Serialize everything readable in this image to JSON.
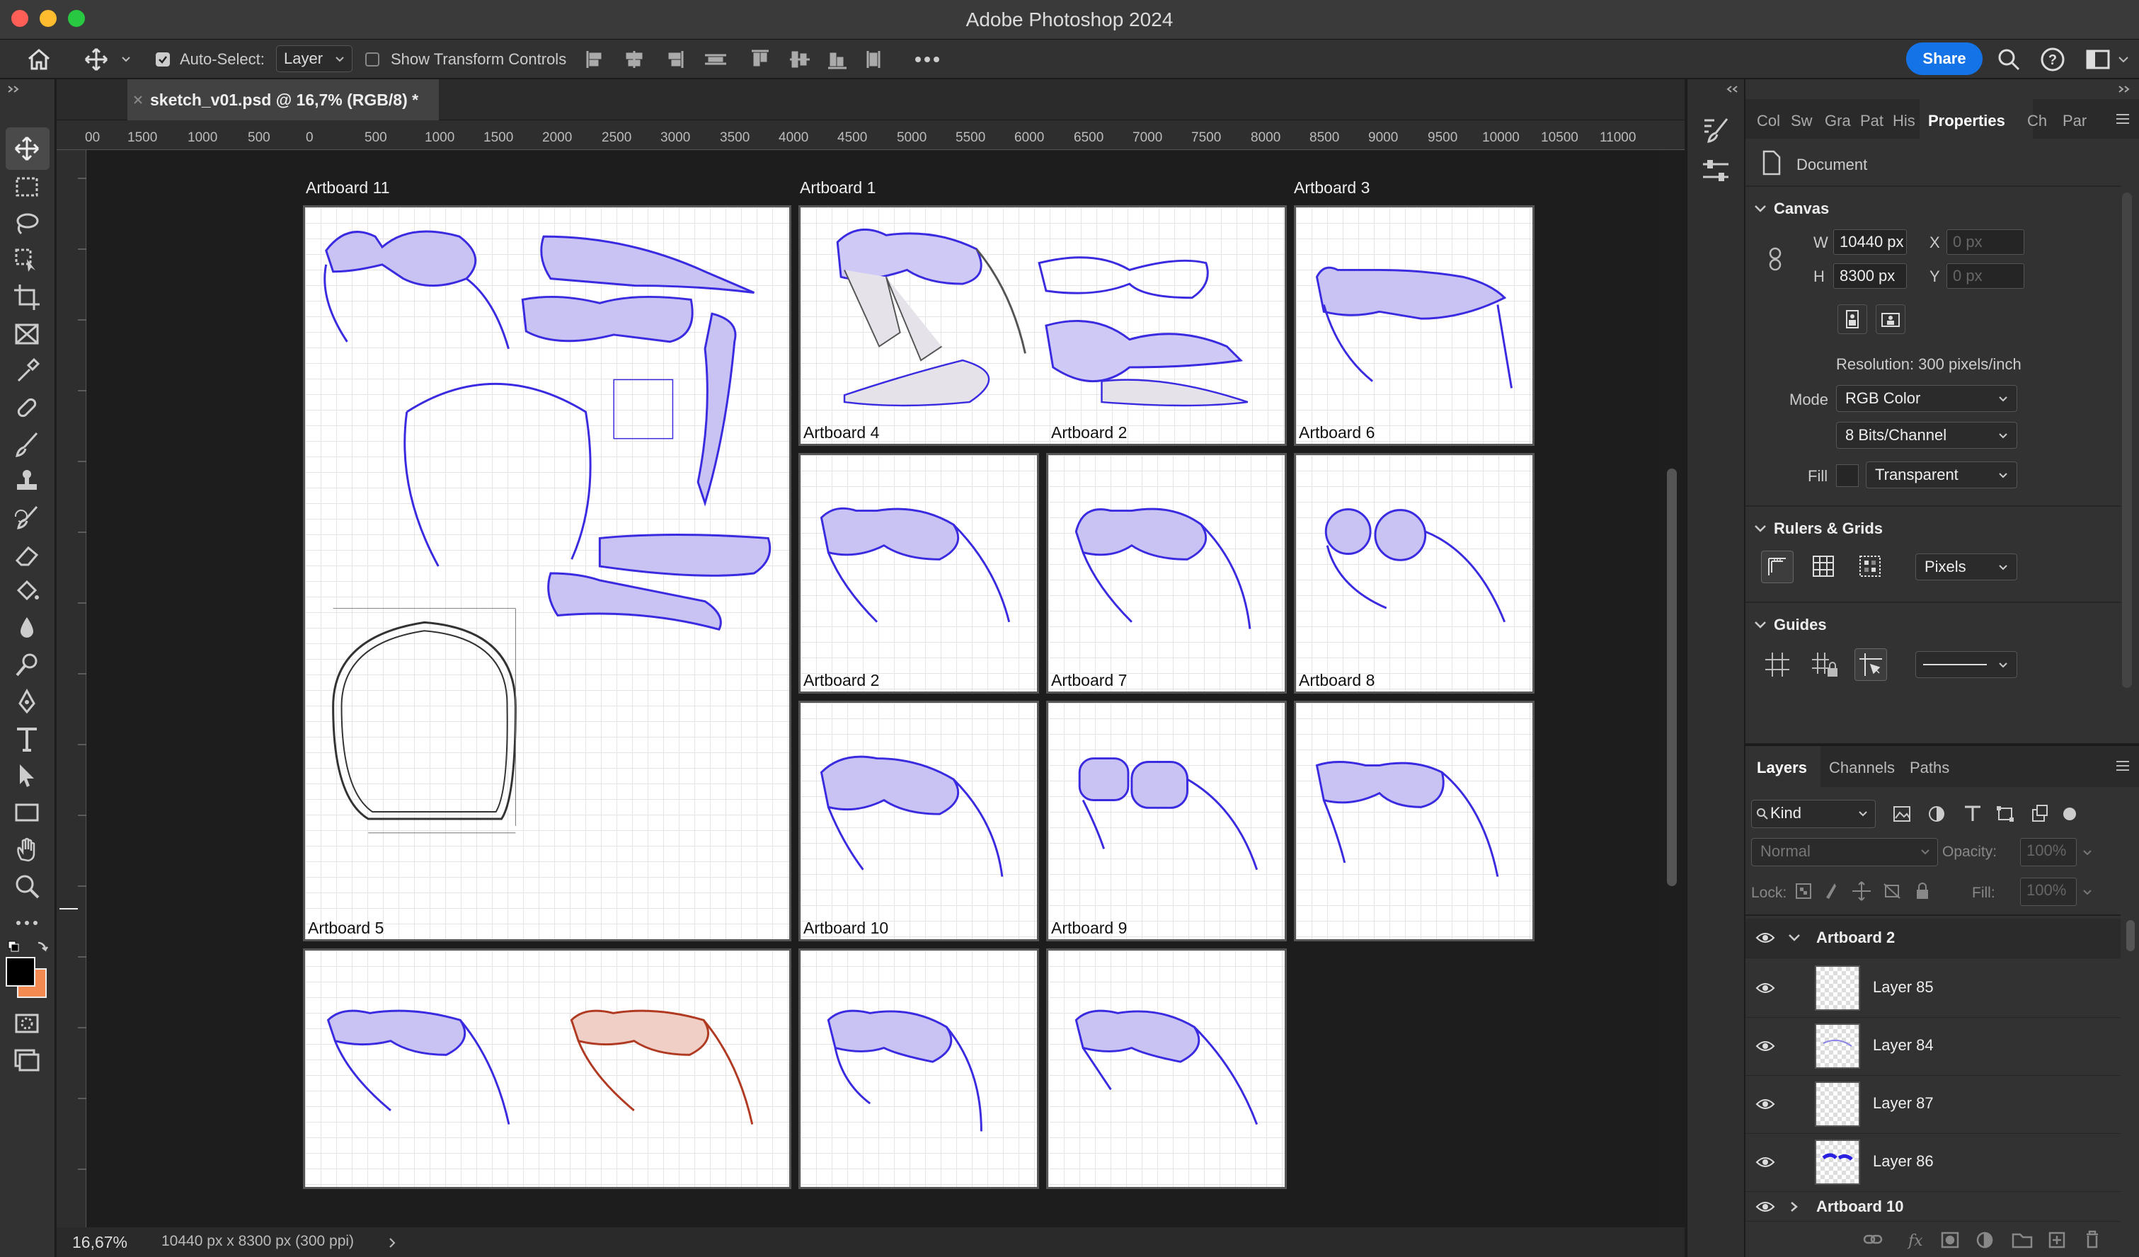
{
  "app_title": "Adobe Photoshop 2024",
  "options": {
    "auto_select_label": "Auto-Select:",
    "auto_select_value": "Layer",
    "show_transform_label": "Show Transform Controls",
    "share_label": "Share"
  },
  "document_tab": "sketch_v01.psd @ 16,7% (RGB/8) *",
  "ruler_ticks": [
    "00",
    "1500",
    "1000",
    "500",
    "0",
    "500",
    "1000",
    "1500",
    "2000",
    "2500",
    "3000",
    "3500",
    "4000",
    "4500",
    "5000",
    "5500",
    "6000",
    "6500",
    "7000",
    "7500",
    "8000",
    "8500",
    "9000",
    "9500",
    "10000",
    "10500",
    "11000"
  ],
  "artboards": {
    "ab11": "Artboard 11",
    "ab1": "Artboard 1",
    "ab3": "Artboard 3",
    "ab4": "Artboard 4",
    "ab2_top": "Artboard 2",
    "ab6": "Artboard 6",
    "ab2": "Artboard 2",
    "ab7": "Artboard 7",
    "ab8": "Artboard 8",
    "ab5": "Artboard 5",
    "ab10": "Artboard 10",
    "ab9": "Artboard 9"
  },
  "status": {
    "zoom": "16,67%",
    "doc_info": "10440 px x 8300 px (300 ppi)"
  },
  "panel_tabs": [
    "Col",
    "Sw",
    "Gra",
    "Pat",
    "His",
    "Properties",
    "Ch",
    "Par"
  ],
  "properties": {
    "document_label": "Document",
    "canvas_title": "Canvas",
    "w_label": "W",
    "w_value": "10440 px",
    "h_label": "H",
    "h_value": "8300 px",
    "x_label": "X",
    "x_placeholder": "0 px",
    "y_label": "Y",
    "y_placeholder": "0 px",
    "resolution": "Resolution: 300 pixels/inch",
    "mode_label": "Mode",
    "mode_value": "RGB Color",
    "bits_value": "8 Bits/Channel",
    "fill_label": "Fill",
    "fill_value": "Transparent",
    "rulers_title": "Rulers & Grids",
    "units_value": "Pixels",
    "guides_title": "Guides"
  },
  "layers_panel": {
    "tabs": [
      "Layers",
      "Channels",
      "Paths"
    ],
    "kind_label": "Kind",
    "blend_mode": "Normal",
    "opacity_label": "Opacity:",
    "opacity_value": "100%",
    "lock_label": "Lock:",
    "fill_label": "Fill:",
    "fill_value": "100%",
    "group_open": "Artboard 2",
    "layers": [
      "Layer 85",
      "Layer 84",
      "Layer 87",
      "Layer 86"
    ],
    "group_closed": "Artboard 10"
  }
}
